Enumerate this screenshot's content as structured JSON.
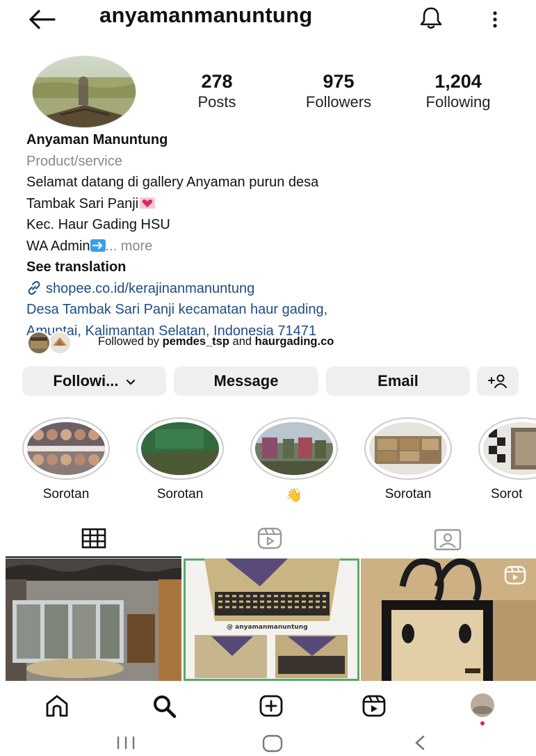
{
  "header": {
    "username": "anyamanmanuntung",
    "back_icon": "back-arrow-icon",
    "bell_icon": "bell-icon",
    "more_icon": "more-vertical-icon"
  },
  "stats": [
    {
      "value": "278",
      "label": "Posts"
    },
    {
      "value": "975",
      "label": "Followers"
    },
    {
      "value": "1,204",
      "label": "Following"
    }
  ],
  "bio": {
    "name": "Anyaman Manuntung",
    "category": "Product/service",
    "line1": "Selamat datang di gallery Anyaman purun desa",
    "line2": "Tambak Sari Panji",
    "line3": "Kec. Haur Gading HSU",
    "line4": "WA Admin",
    "more": "... more",
    "see_translation": "See translation",
    "link": "shopee.co.id/kerajinanmanuntung",
    "address_line1": "Desa Tambak Sari Panji kecamatan haur gading,",
    "address_line2": "Amuntai, Kalimantan Selatan, Indonesia 71471"
  },
  "followed_by": {
    "prefix": "Followed by",
    "user1": "pemdes_tsp",
    "and": "and",
    "user2": "haurgading.co"
  },
  "actions": {
    "following": "Followi...",
    "message": "Message",
    "email": "Email"
  },
  "highlights": [
    {
      "label": "Sorotan"
    },
    {
      "label": "Sorotan"
    },
    {
      "label": "👋"
    },
    {
      "label": "Sorotan"
    },
    {
      "label": "Sorot"
    }
  ],
  "grid_watermark": "@ anyamanmanuntung",
  "colors": {
    "link": "#1f4b88",
    "button_bg": "#efefef",
    "secondary_text": "#888888",
    "notification_dot": "#e0245e"
  }
}
